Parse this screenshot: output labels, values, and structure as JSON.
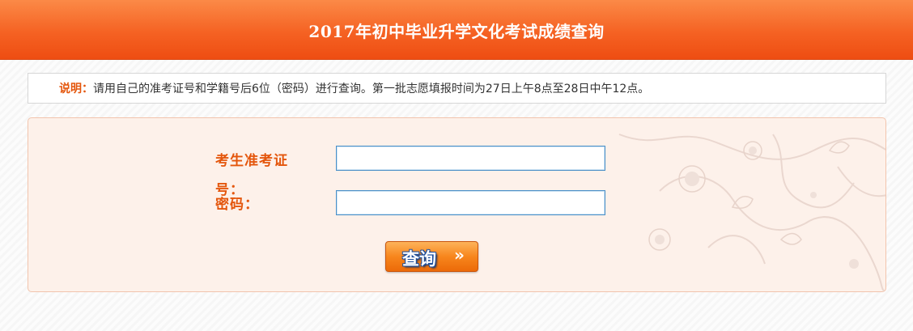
{
  "header": {
    "title": "2017年初中毕业升学文化考试成绩查询"
  },
  "notice": {
    "label": "说明：",
    "text": "请用自己的准考证号和学籍号后6位（密码）进行查询。第一批志愿填报时间为27日上午8点至28日中午12点。"
  },
  "form": {
    "exam_id_label_line1": "考生准考证",
    "exam_id_label_line2": "号：",
    "exam_id_value": "",
    "password_label": "密码：",
    "password_value": ""
  },
  "buttons": {
    "query_label": "查询",
    "query_arrow": "»"
  },
  "colors": {
    "header_gradient_top": "#fb8a47",
    "header_gradient_bottom": "#ee4d12",
    "accent_label": "#e4560c",
    "input_border": "#4a90c8",
    "panel_bg": "#fdf1ea"
  },
  "icons": {
    "background_decoration": "floral-swirl-decoration"
  }
}
